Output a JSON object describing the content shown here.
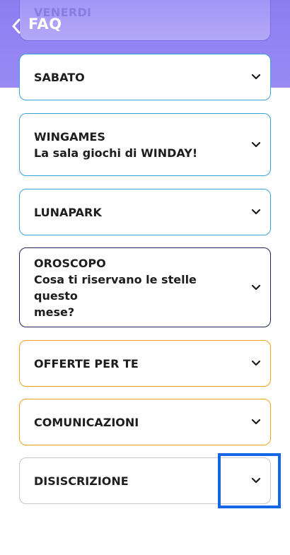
{
  "header": {
    "title": "FAQ",
    "accent": "#8c7ef2",
    "peek_item": "VENERDI"
  },
  "faq_items": [
    {
      "line1": "SABATO",
      "line2": "",
      "line3": "",
      "border": "#3aa4dc"
    },
    {
      "line1": "WINGAMES",
      "line2": "La sala giochi di WINDAY!",
      "line3": "",
      "border": "#3aa4dc"
    },
    {
      "line1": "LUNAPARK",
      "line2": "",
      "line3": "",
      "border": "#3aa4dc"
    },
    {
      "line1": "OROSCOPO",
      "line2": "Cosa ti riservano le stelle questo",
      "line3": "mese?",
      "border": "#1b2556"
    },
    {
      "line1": "OFFERTE PER TE",
      "line2": "",
      "line3": "",
      "border": "#f0a31b"
    },
    {
      "line1": "COMUNICAZIONI",
      "line2": "",
      "line3": "",
      "border": "#f0a31b"
    },
    {
      "line1": "DISISCRIZIONE",
      "line2": "",
      "line3": "",
      "border": "#c8c8c8"
    }
  ],
  "icons": {
    "back": "chevron-left-icon",
    "expand": "chevron-down-icon"
  },
  "highlight_color": "#1565e8"
}
